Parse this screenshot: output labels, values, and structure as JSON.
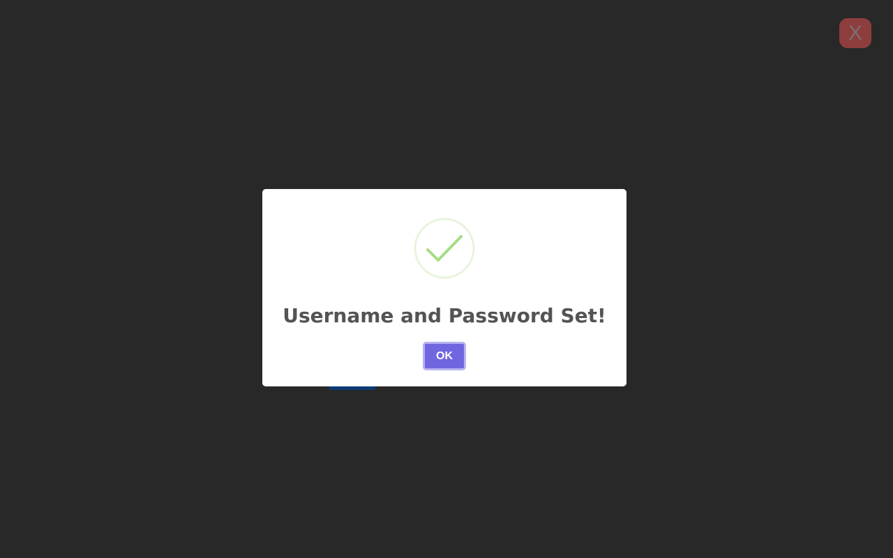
{
  "close_button": {
    "label": "X",
    "color": "#8e3d3d"
  },
  "dialog": {
    "icon": "success-check-icon",
    "icon_color": "#a5dc86",
    "title": "Username and Password Set!",
    "ok_label": "OK",
    "ok_color": "#7066e0"
  },
  "background": {
    "color": "#282828"
  }
}
